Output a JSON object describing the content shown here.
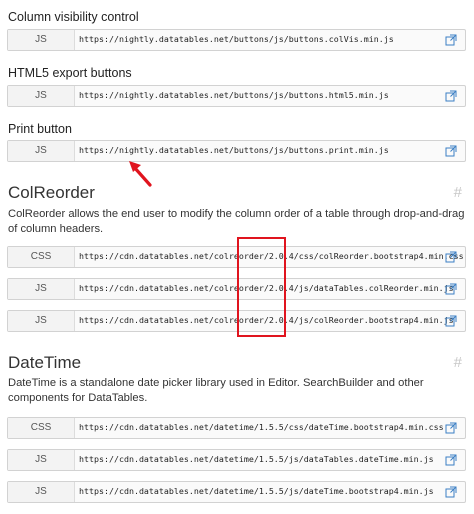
{
  "sections": [
    {
      "heading": "Column visibility control",
      "badge": "JS",
      "url": "https://nightly.datatables.net/buttons/js/buttons.colVis.min.js"
    },
    {
      "heading": "HTML5 export buttons",
      "badge": "JS",
      "url": "https://nightly.datatables.net/buttons/js/buttons.html5.min.js"
    },
    {
      "heading": "Print button",
      "badge": "JS",
      "url": "https://nightly.datatables.net/buttons/js/buttons.print.min.js"
    }
  ],
  "colreorder": {
    "title": "ColReorder",
    "hash": "#",
    "description": "ColReorder allows the end user to modify the column order of a table through drop-and-drag of column headers.",
    "rows": [
      {
        "badge": "CSS",
        "url": "https://cdn.datatables.net/colreorder/2.0.4/css/colReorder.bootstrap4.min.css"
      },
      {
        "badge": "JS",
        "url": "https://cdn.datatables.net/colreorder/2.0.4/js/dataTables.colReorder.min.js"
      },
      {
        "badge": "JS",
        "url": "https://cdn.datatables.net/colreorder/2.0.4/js/colReorder.bootstrap4.min.js"
      }
    ]
  },
  "datetime": {
    "title": "DateTime",
    "hash": "#",
    "description": "DateTime is a standalone date picker library used in Editor. SearchBuilder and other components for DataTables.",
    "rows": [
      {
        "badge": "CSS",
        "url": "https://cdn.datatables.net/datetime/1.5.5/css/dateTime.bootstrap4.min.css"
      },
      {
        "badge": "JS",
        "url": "https://cdn.datatables.net/datetime/1.5.5/js/dataTables.dateTime.min.js"
      },
      {
        "badge": "JS",
        "url": "https://cdn.datatables.net/datetime/1.5.5/js/dateTime.bootstrap4.min.js"
      }
    ]
  },
  "icons": {
    "copy": "open-in-new-icon"
  },
  "colors": {
    "annotation": "#e0141e",
    "icon": "#3b7fc4"
  }
}
